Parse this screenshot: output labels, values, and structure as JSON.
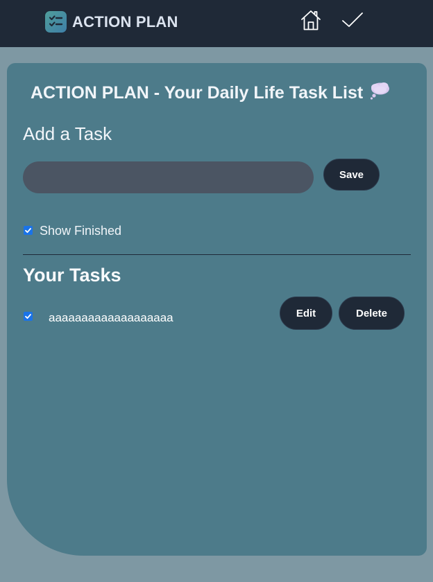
{
  "navbar": {
    "brand": "ACTION PLAN",
    "icons": [
      "checklist-logo-icon",
      "home-icon",
      "check-icon"
    ]
  },
  "main": {
    "title": "ACTION PLAN - Your Daily Life Task List",
    "title_icon": "thought-cloud-icon",
    "add_heading": "Add a Task",
    "input": {
      "value": "",
      "placeholder": ""
    },
    "save_label": "Save",
    "show_finished": {
      "label": "Show Finished",
      "checked": true
    },
    "tasks_heading": "Your Tasks",
    "tasks": [
      {
        "text": "aaaaaaaaaaaaaaaaaaa",
        "done": true,
        "edit_label": "Edit",
        "delete_label": "Delete"
      }
    ]
  },
  "colors": {
    "navbar": "#1f2937",
    "page_background": "#7e98a3",
    "card": "#4d7b8a",
    "input": "#4b5563",
    "button": "#1f2937",
    "checkbox": "#1a73e8",
    "brand_text": "#dbe3ef"
  }
}
